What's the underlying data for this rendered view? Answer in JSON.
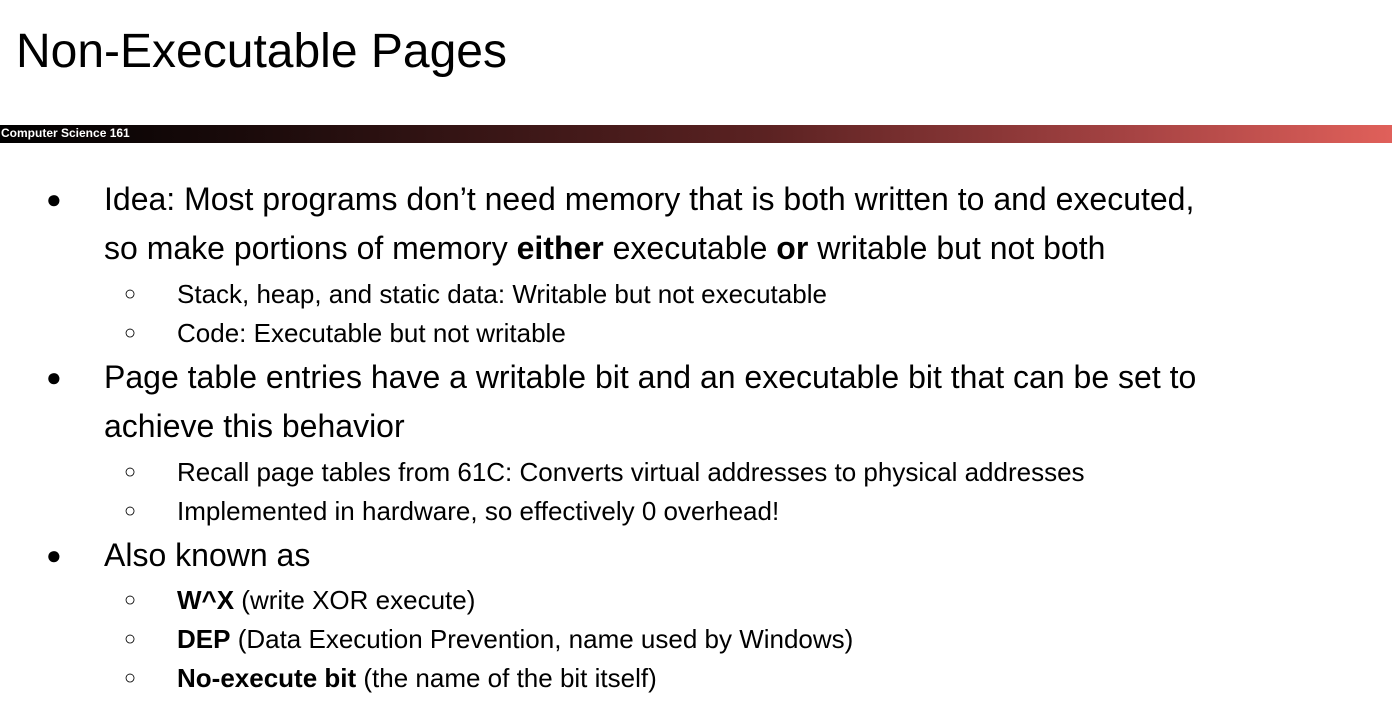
{
  "slide": {
    "title": "Non-Executable Pages",
    "course": "Computer Science 161"
  },
  "bullets": [
    {
      "marker": "●",
      "line1": "Idea: Most programs don’t need memory that is both written to and executed,",
      "line2_a": "so make portions of memory ",
      "line2_b": "either",
      "line2_c": " executable ",
      "line2_d": "or",
      "line2_e": " writable but not both",
      "subs": [
        {
          "marker": "○",
          "text": "Stack, heap, and static data: Writable but not executable"
        },
        {
          "marker": "○",
          "text": "Code: Executable but not writable"
        }
      ]
    },
    {
      "marker": "●",
      "line1": "Page table entries have a writable bit and an executable bit that can be set to",
      "line2": "achieve this behavior",
      "subs": [
        {
          "marker": "○",
          "text": "Recall page tables from 61C: Converts virtual addresses to physical addresses"
        },
        {
          "marker": "○",
          "text": "Implemented in hardware, so effectively 0 overhead!"
        }
      ]
    },
    {
      "marker": "●",
      "line1": "Also known as",
      "subs": [
        {
          "marker": "○",
          "bold": "W^X",
          "text": " (write XOR execute)"
        },
        {
          "marker": "○",
          "bold": "DEP",
          "text": " (Data Execution Prevention, name used by Windows)"
        },
        {
          "marker": "○",
          "bold": "No-execute bit",
          "text": " (the name of the bit itself)"
        }
      ]
    }
  ]
}
